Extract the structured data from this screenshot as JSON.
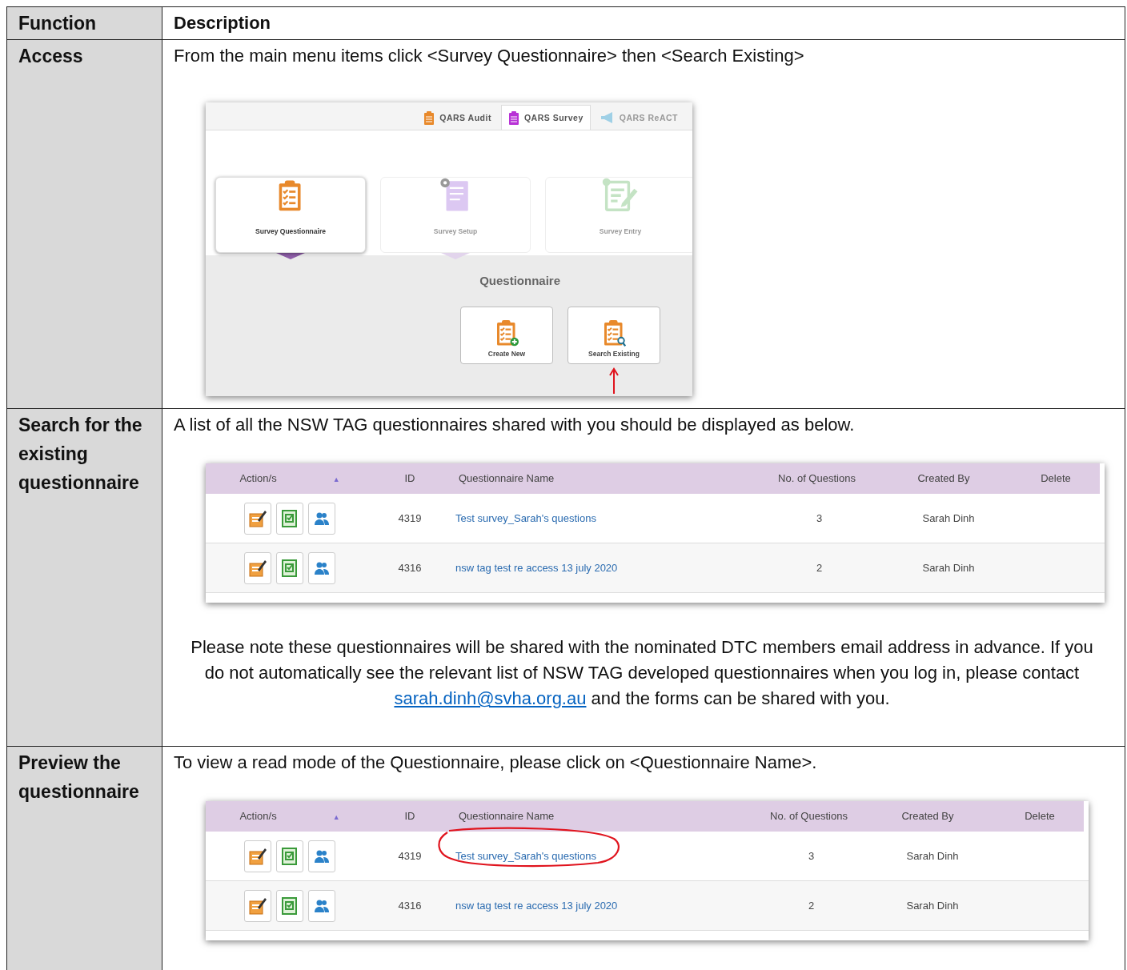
{
  "header": {
    "function": "Function",
    "description": "Description"
  },
  "rows": [
    {
      "function": "Access",
      "description": "From the main menu items click <Survey Questionnaire> then <Search Existing>",
      "figure": {
        "kind": "menu",
        "tabs": [
          {
            "label": "QARS Audit",
            "selected": false,
            "disabled": false,
            "color": "#e8892b"
          },
          {
            "label": "QARS Survey",
            "selected": true,
            "disabled": false,
            "color": "#b832d6"
          },
          {
            "label": "QARS ReACT",
            "selected": false,
            "disabled": true,
            "color": "#9fd0e6"
          }
        ],
        "tiles": [
          {
            "label": "Survey Questionnaire",
            "disabled": false,
            "selected": true,
            "color": "#e8892b"
          },
          {
            "label": "Survey Setup",
            "disabled": true,
            "selected": false,
            "color": "#dcc8f2"
          },
          {
            "label": "Survey Entry",
            "disabled": true,
            "selected": false,
            "color": "#c4e3c4"
          }
        ],
        "section_title": "Questionnaire",
        "buttons": [
          {
            "label": "Create New",
            "kind": "create",
            "pointed": false
          },
          {
            "label": "Search Existing",
            "kind": "search",
            "pointed": true
          }
        ]
      }
    },
    {
      "function": "Search for the existing questionnaire",
      "description": "A list of all the NSW TAG questionnaires shared with you should be displayed as below.",
      "figure": {
        "kind": "table",
        "columns": [
          "Action/s",
          "ID",
          "Questionnaire Name",
          "No. of Questions",
          "Created By",
          "Delete"
        ],
        "sort_indicator": "▲",
        "rows": [
          {
            "id": "4319",
            "name": "Test survey_Sarah's questions",
            "questions": "3",
            "created_by": "Sarah Dinh",
            "circled": false
          },
          {
            "id": "4316",
            "name": "nsw tag test re access 13 july 2020",
            "questions": "2",
            "created_by": "Sarah Dinh",
            "circled": false
          }
        ]
      },
      "note": {
        "before": "Please note these questionnaires will be shared with the nominated DTC members email address in advance. If you do not automatically see the relevant list of NSW TAG developed questionnaires when you log in, please contact ",
        "link": "sarah.dinh@svha.org.au",
        "after": " and the forms can be shared with you."
      }
    },
    {
      "function": "Preview the questionnaire",
      "description": "To view a read mode of the Questionnaire, please click on <Questionnaire Name>.",
      "figure": {
        "kind": "table",
        "columns": [
          "Action/s",
          "ID",
          "Questionnaire Name",
          "No. of Questions",
          "Created By",
          "Delete"
        ],
        "sort_indicator": "▲",
        "rows": [
          {
            "id": "4319",
            "name": "Test survey_Sarah's questions",
            "questions": "3",
            "created_by": "Sarah Dinh",
            "circled": true
          },
          {
            "id": "4316",
            "name": "nsw tag test re access 13 july 2020",
            "questions": "2",
            "created_by": "Sarah Dinh",
            "circled": false
          }
        ]
      }
    }
  ]
}
